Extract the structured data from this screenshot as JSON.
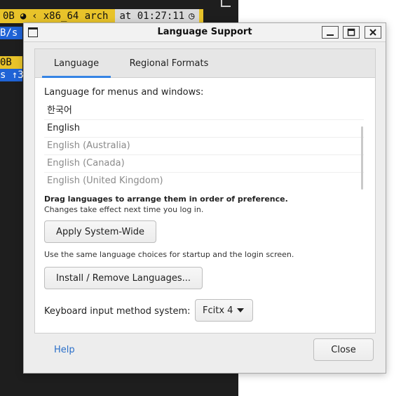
{
  "terminal": {
    "bar_seg1": "0B",
    "bar_seg2": "x86_64 arch",
    "bar_time": "at 01:27:11",
    "line1": "B/s",
    "line2": "0B",
    "line3": "s ↑3"
  },
  "window": {
    "title": "Language Support"
  },
  "tabs": [
    {
      "label": "Language"
    },
    {
      "label": "Regional Formats"
    }
  ],
  "language": {
    "section_label": "Language for menus and windows:",
    "items": [
      {
        "label": "한국어"
      },
      {
        "label": "English"
      },
      {
        "label": "English (Australia)"
      },
      {
        "label": "English (Canada)"
      },
      {
        "label": "English (United Kingdom)"
      }
    ],
    "drag_note": "Drag languages to arrange them in order of preference.",
    "change_note": "Changes take effect next time you log in.",
    "apply_button": "Apply System-Wide",
    "apply_note": "Use the same language choices for startup and the login screen.",
    "install_button": "Install / Remove Languages...",
    "keyboard_label": "Keyboard input method system:",
    "keyboard_value": "Fcitx 4"
  },
  "footer": {
    "help": "Help",
    "close": "Close"
  },
  "colors": {
    "accent": "#3584e4",
    "terminal_bar": "#e8c32a",
    "terminal_blue": "#1f63d6",
    "link": "#2a6fc9"
  }
}
